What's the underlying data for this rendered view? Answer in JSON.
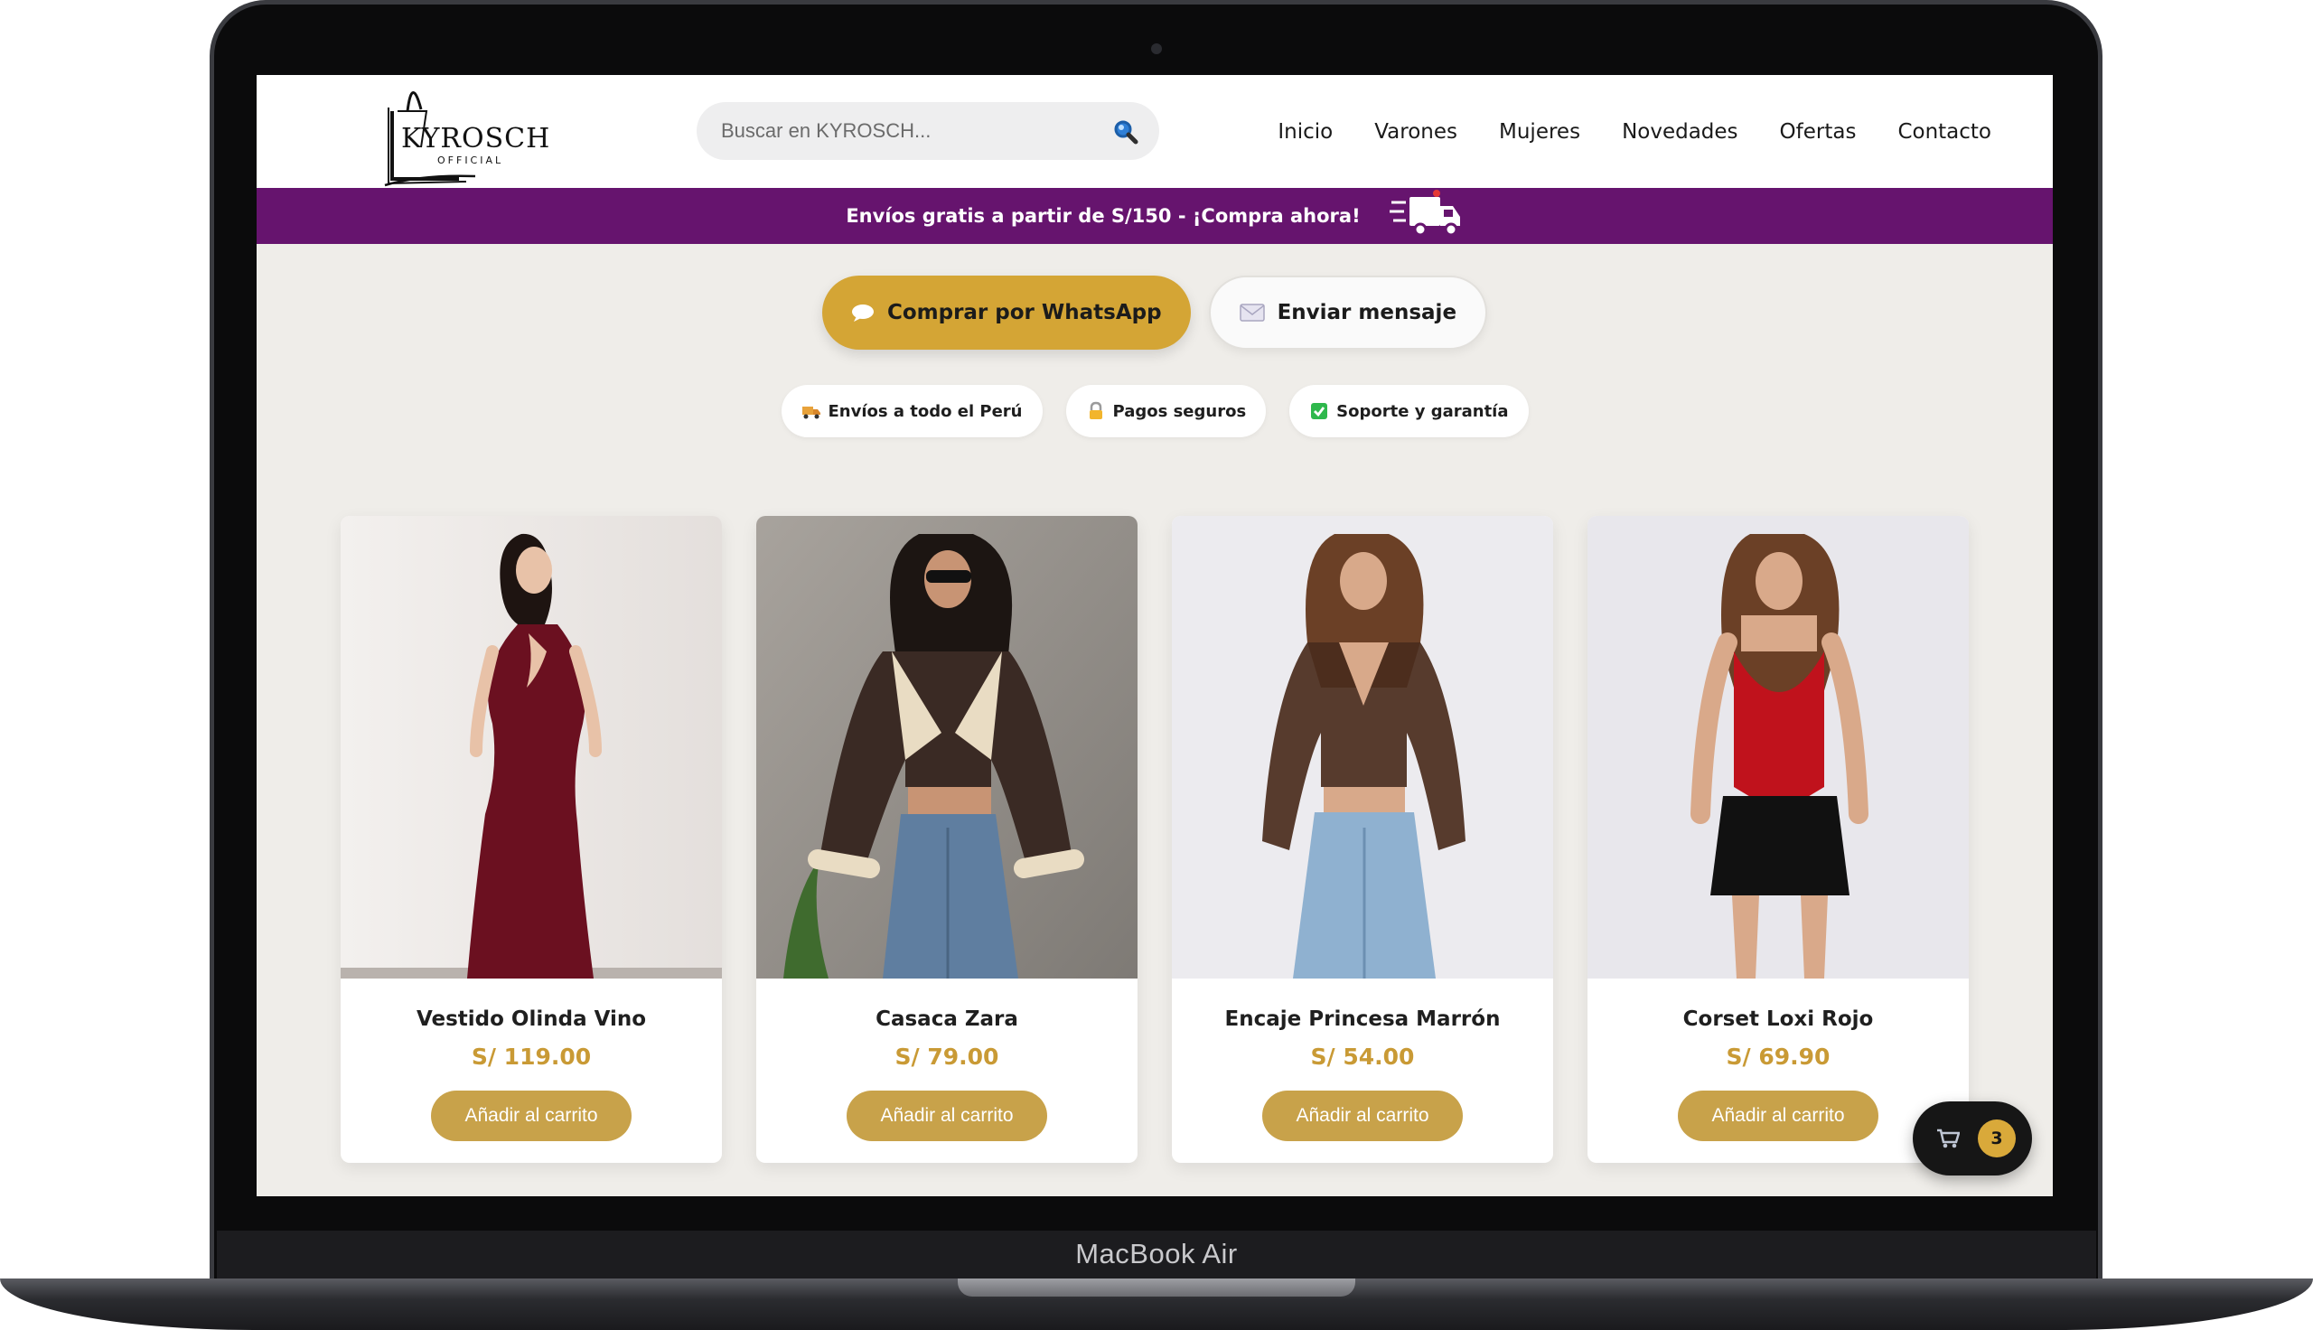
{
  "device": {
    "model_label": "MacBook Air"
  },
  "header": {
    "logo": {
      "brand": "KYROSCH",
      "sub": "OFFICIAL"
    },
    "search": {
      "placeholder": "Buscar en KYROSCH...",
      "value": ""
    },
    "nav": [
      "Inicio",
      "Varones",
      "Mujeres",
      "Novedades",
      "Ofertas",
      "Contacto"
    ]
  },
  "promo": {
    "text": "Envíos gratis a partir de S/150 - ¡Compra ahora!"
  },
  "cta": {
    "whatsapp_label": "Comprar por WhatsApp",
    "message_label": "Enviar mensaje"
  },
  "features": [
    {
      "label": "Envíos a todo el Perú",
      "icon": "truck-icon"
    },
    {
      "label": "Pagos seguros",
      "icon": "lock-icon"
    },
    {
      "label": "Soporte y garantía",
      "icon": "checkmark-icon"
    }
  ],
  "products": [
    {
      "name": "Vestido Olinda Vino",
      "price": "S/ 119.00",
      "button": "Añadir al carrito"
    },
    {
      "name": "Casaca Zara",
      "price": "S/ 79.00",
      "button": "Añadir al carrito"
    },
    {
      "name": "Encaje Princesa Marrón",
      "price": "S/ 54.00",
      "button": "Añadir al carrito"
    },
    {
      "name": "Corset Loxi Rojo",
      "price": "S/ 69.90",
      "button": "Añadir al carrito"
    }
  ],
  "cart": {
    "count": "3",
    "icon": "cart-icon"
  },
  "colors": {
    "promo_bar": "#66146e",
    "accent_gold": "#d4a535",
    "price_gold": "#c99a35",
    "background": "#efede9"
  }
}
